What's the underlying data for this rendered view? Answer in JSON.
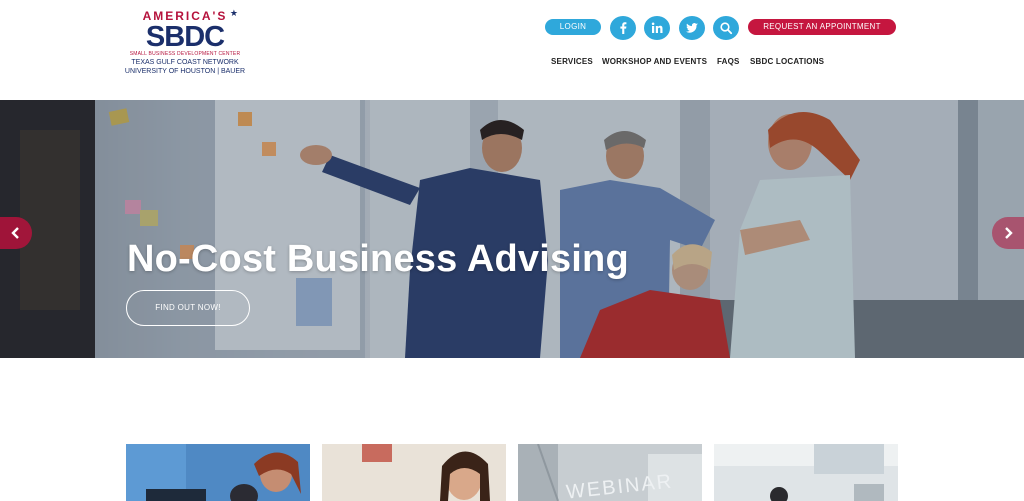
{
  "logo": {
    "americas": "AMERICA'S",
    "sbdc": "SBDC",
    "subtitle": "SMALL BUSINESS DEVELOPMENT CENTER",
    "network": "TEXAS GULF COAST NETWORK",
    "university": "UNIVERSITY OF HOUSTON | BAUER"
  },
  "topbar": {
    "login_label": "LOGIN",
    "appointment_label": "REQUEST AN APPOINTMENT",
    "social": {
      "facebook_icon": "facebook-icon",
      "linkedin_icon": "linkedin-icon",
      "twitter_icon": "twitter-icon",
      "search_icon": "search-icon"
    }
  },
  "nav": {
    "items": [
      "SERVICES",
      "WORKSHOP AND EVENTS",
      "FAQS",
      "SBDC LOCATIONS"
    ]
  },
  "hero": {
    "title": "No-Cost Business Advising",
    "cta_label": "FIND OUT NOW!",
    "prev_icon": "chevron-left-icon",
    "next_icon": "chevron-right-icon"
  },
  "cards": {
    "webinar_text": "WEBINAR"
  },
  "colors": {
    "accent_blue": "#2fa8db",
    "accent_red": "#c5163f",
    "brand_navy": "#1b2f6b"
  }
}
